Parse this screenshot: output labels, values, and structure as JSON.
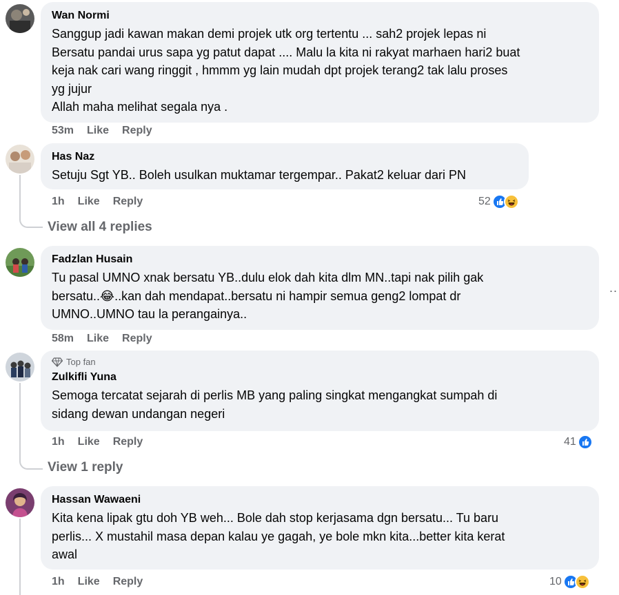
{
  "comments": [
    {
      "author": "Wan Normi",
      "text": "Sanggup jadi kawan makan demi projek utk org tertentu ... sah2 projek lepas ni\nBersatu pandai urus sapa yg patut dapat .... Malu la kita ni rakyat marhaen hari2 buat\nkeja nak cari wang ringgit , hmmm yg lain mudah dpt projek terang2 tak lalu proses\nyg jujur\nAllah maha melihat segala nya .",
      "time": "53m",
      "like": "Like",
      "reply": "Reply"
    },
    {
      "author": "Has Naz",
      "text": "Setuju Sgt YB.. Boleh usulkan muktamar tergempar.. Pakat2 keluar dari PN",
      "time": "1h",
      "like": "Like",
      "reply": "Reply",
      "reaction_count": "52",
      "reaction_icons": [
        "like-icon",
        "haha-icon"
      ],
      "view_replies": "View all 4 replies"
    },
    {
      "author": "Fadzlan Husain",
      "text": "Tu pasal UMNO xnak bersatu YB..dulu elok dah kita dlm MN..tapi nak pilih gak\nbersatu..😂..kan dah mendapat..bersatu ni hampir semua geng2 lompat dr\nUMNO..UMNO tau la perangainya..",
      "time": "58m",
      "like": "Like",
      "reply": "Reply"
    },
    {
      "badge": "Top fan",
      "author": "Zulkifli Yuna",
      "text": "Semoga tercatat sejarah di perlis MB yang paling singkat mengangkat sumpah di\nsidang dewan undangan negeri",
      "time": "1h",
      "like": "Like",
      "reply": "Reply",
      "reaction_count": "41",
      "reaction_icons": [
        "like-icon"
      ],
      "view_replies": "View 1 reply"
    },
    {
      "author": "Hassan Wawaeni",
      "text": "Kita kena lipak gtu doh YB weh... Bole dah stop kerjasama dgn bersatu... Tu baru\nperlis... X mustahil masa depan kalau ye gagah, ye bole mkn kita...better kita kerat\nawal",
      "time": "1h",
      "like": "Like",
      "reply": "Reply",
      "reaction_count": "10",
      "reaction_icons": [
        "like-icon",
        "haha-icon"
      ]
    }
  ],
  "more_menu": "..",
  "colors": {
    "bubble": "#f0f2f5",
    "secondary_text": "#65676b",
    "like_blue": "#1877f2",
    "haha_yellow": "#f7c03a"
  }
}
